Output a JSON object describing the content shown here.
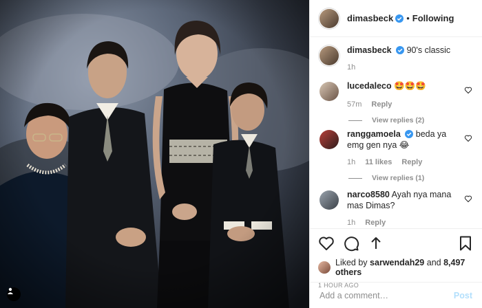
{
  "header": {
    "username": "dimasbeck",
    "separator": "•",
    "follow_status": "Following"
  },
  "caption": {
    "username": "dimasbeck",
    "text": "90's classic",
    "time": "1h"
  },
  "comments": [
    {
      "username": "lucedaleco",
      "text": "🤩🤩🤩",
      "time": "57m",
      "likes": "",
      "reply": "Reply",
      "view_replies": "View replies (2)"
    },
    {
      "username": "ranggamoela",
      "text": "beda ya emg gen nya 😂",
      "time": "1h",
      "likes": "11 likes",
      "reply": "Reply",
      "view_replies": "View replies (1)"
    },
    {
      "username": "narco8580",
      "text": "Ayah nya mana mas Dimas?",
      "time": "1h",
      "likes": "",
      "reply": "Reply",
      "view_replies": ""
    }
  ],
  "likes": {
    "prefix": "Liked by",
    "user": "sarwendah29",
    "connector": "and",
    "count": "8,497 others"
  },
  "timestamp": "1 HOUR AGO",
  "add_comment": {
    "placeholder": "Add a comment…",
    "post_label": "Post"
  },
  "icons": {
    "like": "heart-icon",
    "comment": "comment-icon",
    "share": "share-icon",
    "save": "bookmark-icon",
    "verified": "verified-badge-icon",
    "user_tag": "user-tag-icon"
  },
  "colors": {
    "verified": "#3897f0",
    "muted": "#8e8e8e",
    "post_disabled": "#b2dffc"
  }
}
